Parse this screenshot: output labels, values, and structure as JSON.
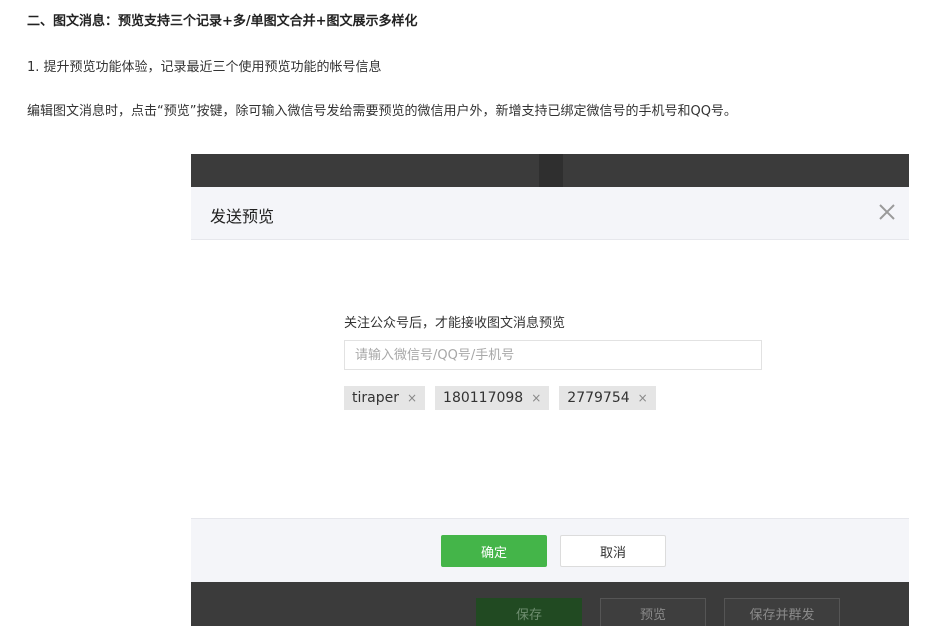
{
  "article": {
    "heading": "二、图文消息：预览支持三个记录+多/单图文合并+图文展示多样化",
    "line1": "1. 提升预览功能体验，记录最近三个使用预览功能的帐号信息",
    "line2": "编辑图文消息时，点击“预览”按键，除可输入微信号发给需要预览的微信用户外，新增支持已绑定微信号的手机号和QQ号。"
  },
  "dialog": {
    "title": "发送预览",
    "tip": "关注公众号后，才能接收图文消息预览",
    "input": {
      "placeholder": "请输入微信号/QQ号/手机号",
      "value": ""
    },
    "tags": [
      {
        "label": "tiraper",
        "close": "×"
      },
      {
        "label": "180117098",
        "close": "×"
      },
      {
        "label": "2779754",
        "close": "×"
      }
    ],
    "confirm_label": "确定",
    "cancel_label": "取消"
  },
  "background_toolbar": {
    "save_label": "保存",
    "preview_label": "预览",
    "save_and_mass_label": "保存并群发"
  },
  "colors": {
    "primary_green": "#44b549",
    "header_bg": "#f4f5f9",
    "overlay": "#3b3b3b"
  }
}
